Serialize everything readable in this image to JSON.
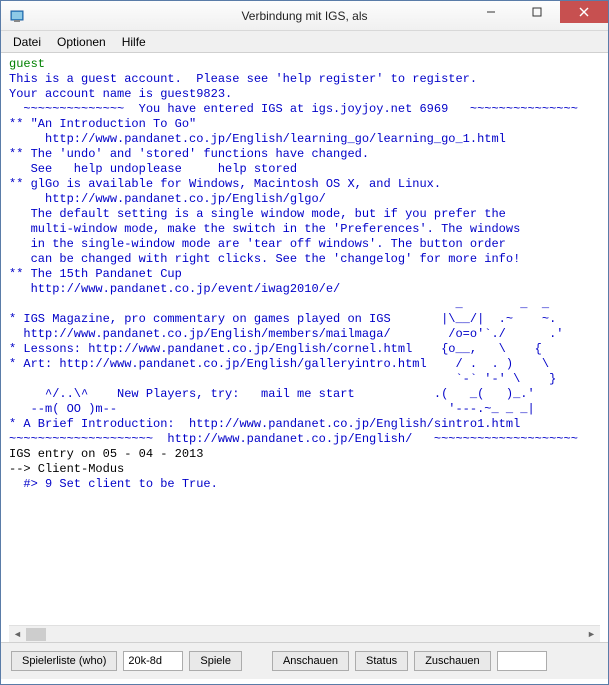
{
  "window": {
    "title": "Verbindung mit IGS, als"
  },
  "menu": {
    "file": "Datei",
    "options": "Optionen",
    "help": "Hilfe"
  },
  "terminal": {
    "guest": "guest",
    "line1": "This is a guest account.  Please see 'help register' to register.",
    "line2": "Your account name is guest9823.",
    "line3": "  ~~~~~~~~~~~~~~  You have entered IGS at igs.joyjoy.net 6969   ~~~~~~~~~~~~~~~",
    "line4": "** \"An Introduction To Go\"",
    "line5": "     http://www.pandanet.co.jp/English/learning_go/learning_go_1.html",
    "line6": "** The 'undo' and 'stored' functions have changed.",
    "line7": "   See   help undoplease     help stored",
    "line8": "** glGo is available for Windows, Macintosh OS X, and Linux.",
    "line9": "     http://www.pandanet.co.jp/English/glgo/",
    "line10": "   The default setting is a single window mode, but if you prefer the",
    "line11": "   multi-window mode, make the switch in the 'Preferences'. The windows",
    "line12": "   in the single-window mode are 'tear off windows'. The button order",
    "line13": "   can be changed with right clicks. See the 'changelog' for more info!",
    "line14": "** The 15th Pandanet Cup",
    "line15": "   http://www.pandanet.co.jp/event/iwag2010/e/",
    "line16": "                                                              _        _  _",
    "line17": "* IGS Magazine, pro commentary on games played on IGS       |\\__/|  .~    ~.",
    "line18": "  http://www.pandanet.co.jp/English/members/mailmaga/        /o=o'`./      .'",
    "line19": "* Lessons: http://www.pandanet.co.jp/English/cornel.html    {o__,   \\    {",
    "line20": "* Art: http://www.pandanet.co.jp/English/galleryintro.html    / .  . )    \\",
    "line21": "                                                              `-` '-' \\    }",
    "line22": "     ^/..\\^    New Players, try:   mail me start           .(   _(   )_.'",
    "line23": "   --m( OO )m--                                              '---.~_ _ _|",
    "line24": "* A Brief Introduction:  http://www.pandanet.co.jp/English/sintro1.html",
    "line25": "~~~~~~~~~~~~~~~~~~~~  http://www.pandanet.co.jp/English/   ~~~~~~~~~~~~~~~~~~~~",
    "line_entry": "IGS entry on 05 - 04 - 2013",
    "line_client": "--> Client-Modus",
    "line_set": "  #> 9 Set client to be True."
  },
  "buttons": {
    "playerlist": "Spielerliste (who)",
    "rank": "20k-8d",
    "games": "Spiele",
    "watch": "Anschauen",
    "status": "Status",
    "observe": "Zuschauen"
  }
}
